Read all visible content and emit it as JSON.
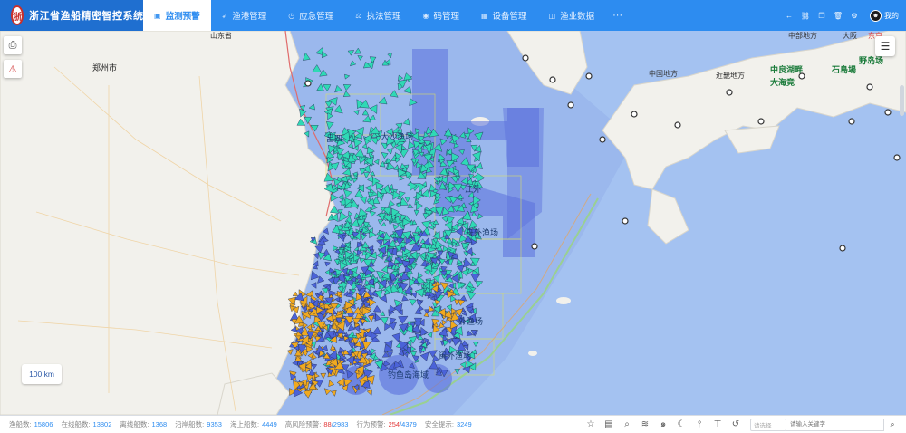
{
  "header": {
    "logo_text": "浙",
    "app_title": "浙江省渔船精密智控系统",
    "nav": [
      {
        "label": "监测预警",
        "icon": "monitor-icon",
        "glyph": "▣",
        "active": true
      },
      {
        "label": "渔港管理",
        "icon": "send-icon",
        "glyph": "➶",
        "active": false
      },
      {
        "label": "应急管理",
        "icon": "clock-icon",
        "glyph": "◷",
        "active": false
      },
      {
        "label": "执法管理",
        "icon": "law-icon",
        "glyph": "⚖",
        "active": false
      },
      {
        "label": "码管理",
        "icon": "eye-icon",
        "glyph": "◉",
        "active": false
      },
      {
        "label": "设备管理",
        "icon": "device-icon",
        "glyph": "▦",
        "active": false
      },
      {
        "label": "渔业数据",
        "icon": "data-icon",
        "glyph": "◫",
        "active": false
      }
    ],
    "more": "···",
    "tools": [
      {
        "name": "back-icon",
        "glyph": "←"
      },
      {
        "name": "link-icon",
        "glyph": "⛓"
      },
      {
        "name": "copy-icon",
        "glyph": "❐"
      },
      {
        "name": "trash-icon",
        "glyph": "🗑"
      },
      {
        "name": "settings-icon",
        "glyph": "⚙"
      }
    ],
    "user": {
      "avatar": "☻",
      "name": "我的"
    }
  },
  "map": {
    "labels": [
      {
        "text": "郑州市",
        "cls": "city"
      },
      {
        "text": "山东省",
        "cls": ""
      },
      {
        "text": "吕四",
        "cls": "sea"
      },
      {
        "text": "大沙渔场",
        "cls": "sea"
      },
      {
        "text": "江外",
        "cls": "sea"
      },
      {
        "text": "舟外渔场",
        "cls": "sea"
      },
      {
        "text": "外渔场",
        "cls": "sea"
      },
      {
        "text": "闽外渔场",
        "cls": "sea"
      },
      {
        "text": "钓鱼岛海域",
        "cls": "sea"
      },
      {
        "text": "中部地方",
        "cls": ""
      },
      {
        "text": "中国地方",
        "cls": ""
      },
      {
        "text": "近畿地方",
        "cls": ""
      },
      {
        "text": "中良湖畔",
        "cls": "jp"
      },
      {
        "text": "大海竟",
        "cls": "jp"
      },
      {
        "text": "石島場",
        "cls": "jp"
      },
      {
        "text": "野岛场",
        "cls": "jp"
      },
      {
        "text": "大阪",
        "cls": ""
      },
      {
        "text": "东京",
        "cls": "red"
      }
    ],
    "scale": "100 km",
    "side_buttons": [
      {
        "name": "camera-icon",
        "glyph": "⎙"
      },
      {
        "name": "alarm-icon",
        "glyph": "⚠"
      }
    ],
    "layer_button": "☰",
    "colors": {
      "sea": "#9bb8ed",
      "land": "#f2f1ec",
      "fishing_zone": "#5a6fdc",
      "boundary": "#e06b6b",
      "boat_cyan": "#2fd9b5",
      "boat_blue": "#4b63d8",
      "boat_orange": "#f0a91f"
    }
  },
  "status": {
    "items": [
      {
        "label": "渔船数:",
        "value": "15806",
        "extra": ""
      },
      {
        "label": "在线船数:",
        "value": "13802",
        "extra": ""
      },
      {
        "label": "离线船数:",
        "value": "1368",
        "extra": ""
      },
      {
        "label": "沿岸船数:",
        "value": "9353",
        "extra": ""
      },
      {
        "label": "海上船数:",
        "value": "4449",
        "extra": ""
      },
      {
        "label": "高风险预警:",
        "value": "88",
        "extra": "/2983"
      },
      {
        "label": "行为预警:",
        "value": "254",
        "extra": "/4379"
      },
      {
        "label": "安全提示:",
        "value": "3249",
        "extra": ""
      }
    ],
    "icons": [
      {
        "name": "star-icon",
        "glyph": "☆"
      },
      {
        "name": "document-icon",
        "glyph": "▤"
      },
      {
        "name": "search-icon",
        "glyph": "⌕"
      },
      {
        "name": "wind-icon",
        "glyph": "≋"
      },
      {
        "name": "typhoon-icon",
        "glyph": "๑"
      },
      {
        "name": "moon-icon",
        "glyph": "☾"
      },
      {
        "name": "thermometer-icon",
        "glyph": "⫯"
      },
      {
        "name": "pin-icon",
        "glyph": "⊤"
      },
      {
        "name": "history-icon",
        "glyph": "↺"
      }
    ],
    "select_placeholder": "请选择",
    "search_placeholder": "请输入关键字"
  }
}
